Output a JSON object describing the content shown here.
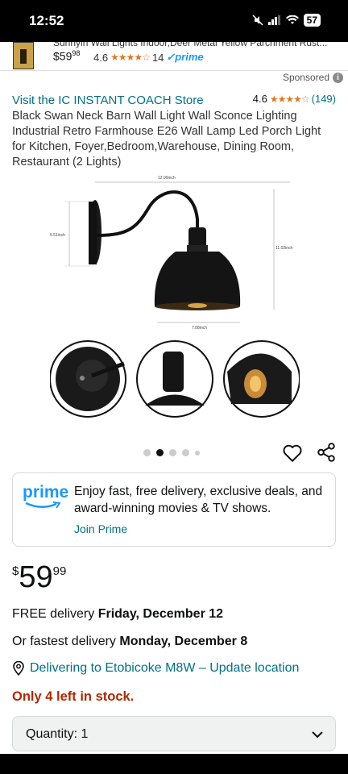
{
  "status": {
    "time": "12:52",
    "battery": "57"
  },
  "mini_bar": {
    "title": "Sunnyin Wall Lights Indoor,Deer Metal Yellow Parchment Rust...",
    "price_whole": "$59",
    "price_frac": "98",
    "rating": "4.6",
    "stars": "★★★★☆",
    "review_count": "14",
    "prime": "✓prime"
  },
  "sponsored": "Sponsored",
  "store": {
    "link": "Visit the IC INSTANT COACH Store",
    "rating": "4.6",
    "stars": "★★★★☆",
    "review_count": "(149)"
  },
  "product_title": "Black Swan Neck Barn Wall Light Wall Sconce Lighting Industrial Retro Farmhouse E26 Wall Lamp Led Porch Light for Kitchen, Foyer,Bedroom,Warehouse, Dining Room, Restaurant (2 Lights)",
  "image_dims": {
    "width": "12.99inch",
    "height_left": "5.51inch",
    "height_right": "11.02inch",
    "shade_width": "7.08inch"
  },
  "carousel": {
    "dot_count": 5,
    "active_index": 1
  },
  "prime_box": {
    "logo": "prime",
    "text": "Enjoy fast, free delivery, exclusive deals, and award-winning movies & TV shows.",
    "join": "Join Prime"
  },
  "price": {
    "currency": "$",
    "whole": "59",
    "fraction": "99"
  },
  "delivery": {
    "free_prefix": "FREE delivery ",
    "free_date": "Friday, December 12",
    "fast_prefix": "Or fastest delivery ",
    "fast_date": "Monday, December 8",
    "location": "Delivering to Etobicoke M8W – Update location"
  },
  "stock": "Only 4 left in stock.",
  "quantity": {
    "label": "Quantity: 1"
  },
  "colors": {
    "link": "#007185",
    "star": "#de7921",
    "prime_blue": "#1a98ff",
    "stock_red": "#b12704"
  }
}
